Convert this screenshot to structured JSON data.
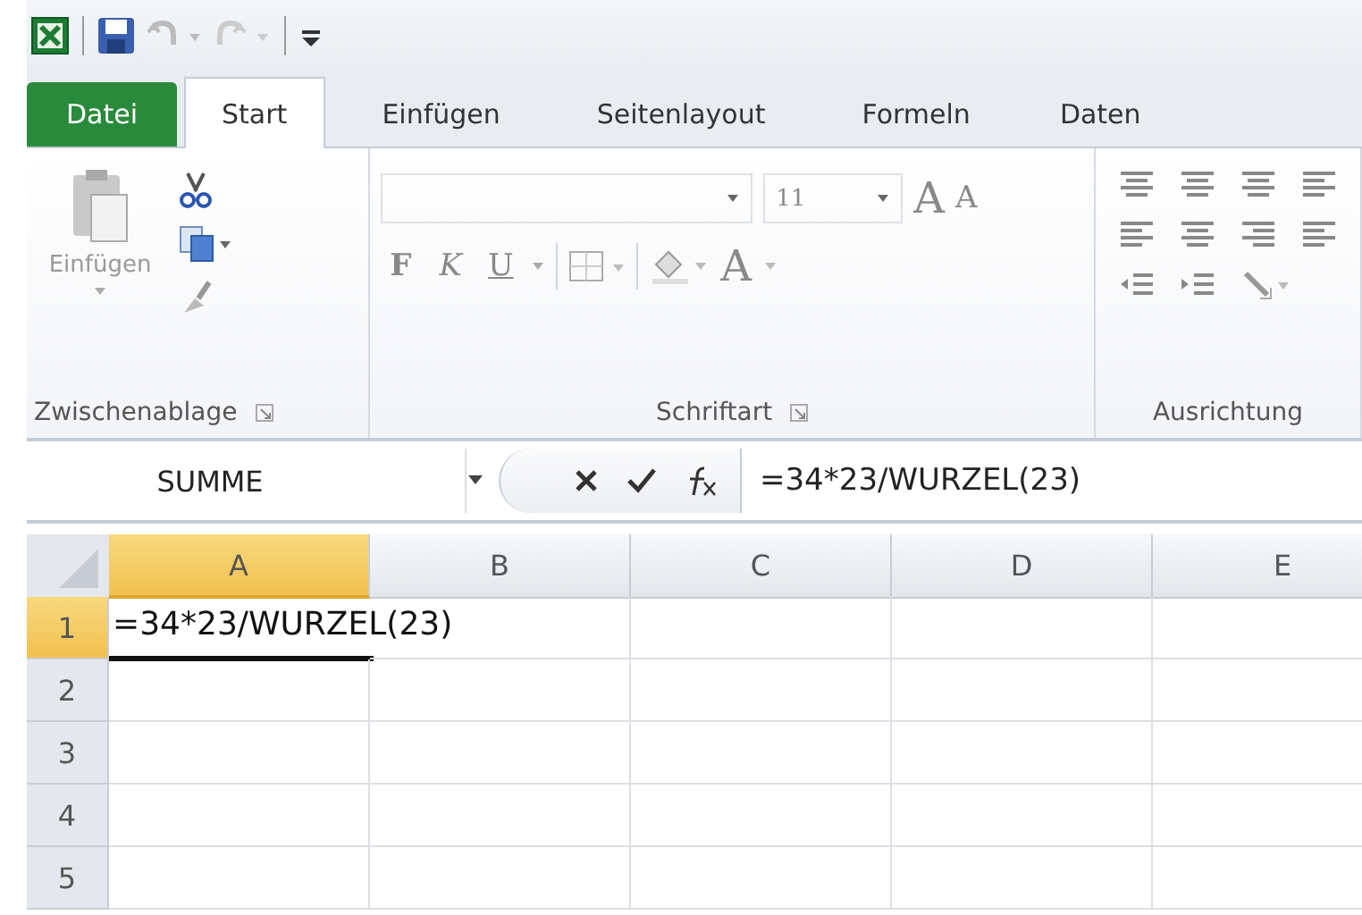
{
  "tabs": [
    {
      "label": "Datei",
      "kind": "file",
      "selected": false
    },
    {
      "label": "Start",
      "kind": "tab",
      "selected": true
    },
    {
      "label": "Einfügen",
      "kind": "tab",
      "selected": false
    },
    {
      "label": "Seitenlayout",
      "kind": "tab",
      "selected": false
    },
    {
      "label": "Formeln",
      "kind": "tab",
      "selected": false
    },
    {
      "label": "Daten",
      "kind": "tab",
      "selected": false
    }
  ],
  "ribbon": {
    "clipboard": {
      "paste_label": "Einfügen",
      "title": "Zwischenablage"
    },
    "font": {
      "size": "11",
      "grow": "A",
      "shrink": "A",
      "bold": "F",
      "italic": "K",
      "underline": "U",
      "font_color": "A",
      "title": "Schriftart"
    },
    "alignment": {
      "title": "Ausrichtung"
    }
  },
  "formula_bar": {
    "name_box": "SUMME",
    "formula": "=34*23/WURZEL(23)"
  },
  "sheet": {
    "columns": [
      {
        "label": "A",
        "selected": true
      },
      {
        "label": "B",
        "selected": false
      },
      {
        "label": "C",
        "selected": false
      },
      {
        "label": "D",
        "selected": false
      },
      {
        "label": "E",
        "selected": false
      }
    ],
    "rows": [
      {
        "label": "1",
        "selected": true
      },
      {
        "label": "2",
        "selected": false
      },
      {
        "label": "3",
        "selected": false
      },
      {
        "label": "4",
        "selected": false
      },
      {
        "label": "5",
        "selected": false
      }
    ],
    "active_cell": {
      "value": "=34*23/WURZEL(23)"
    }
  }
}
